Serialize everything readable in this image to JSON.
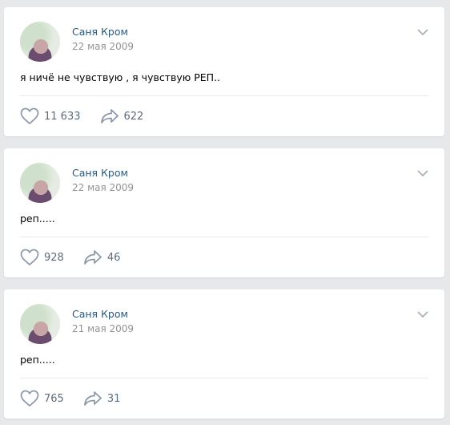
{
  "posts": [
    {
      "author": "Саня Кром",
      "date": "22 мая 2009",
      "text": "я ничё не чувствую , я чувствую РЕП..",
      "likes": "11 633",
      "shares": "622"
    },
    {
      "author": "Саня Кром",
      "date": "22 мая 2009",
      "text": "реп.....",
      "likes": "928",
      "shares": "46"
    },
    {
      "author": "Саня Кром",
      "date": "21 мая 2009",
      "text": "реп.....",
      "likes": "765",
      "shares": "31"
    }
  ],
  "icons": {
    "like": "heart-icon",
    "share": "share-arrow-icon",
    "menu": "chevron-down-icon"
  },
  "colors": {
    "author": "#2a5885",
    "date": "#939393",
    "counts": "#5b6b7f",
    "background": "#e7e8ea"
  }
}
